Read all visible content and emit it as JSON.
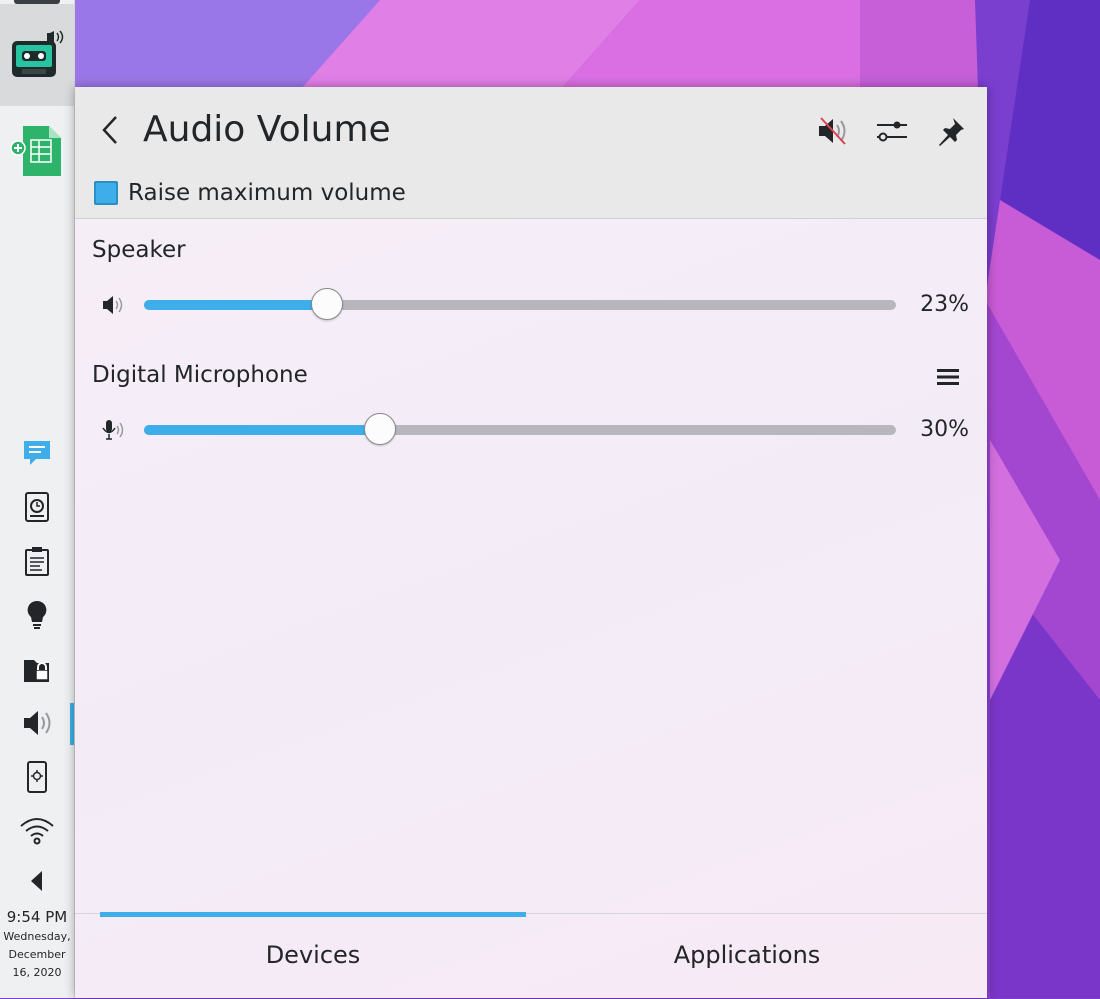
{
  "popup": {
    "title": "Audio Volume",
    "header_icons": [
      "back-icon",
      "speaker-muted-icon",
      "mixer-settings-icon",
      "pin-icon"
    ],
    "raise_max_volume": {
      "label": "Raise maximum volume",
      "checked": true
    }
  },
  "devices": [
    {
      "name": "Speaker",
      "icon": "speaker-icon",
      "volume": 23,
      "volume_label": "23%"
    },
    {
      "name": "Digital Microphone",
      "icon": "microphone-icon",
      "volume": 30,
      "volume_label": "30%",
      "has_menu": true
    }
  ],
  "tabs": [
    {
      "label": "Devices",
      "active": true
    },
    {
      "label": "Applications",
      "active": false
    }
  ],
  "taskbar": {
    "launchers": [
      "cassette-app-icon",
      "spreadsheet-app-icon"
    ],
    "tray_icons": [
      "notifications-icon",
      "disk-backup-icon",
      "clipboard-icon",
      "lightbulb-icon",
      "vault-icon",
      "volume-icon",
      "phone-connect-icon",
      "wifi-icon",
      "expand-tray-icon"
    ],
    "active_tray": "volume-icon"
  },
  "clock": {
    "time": "9:54 PM",
    "date_line1": "Wednesday,",
    "date_line2": "December",
    "date_line3": "16, 2020"
  },
  "colors": {
    "accent": "#3daee9",
    "track": "#b9b5bd",
    "panel": "#eff0f1"
  }
}
